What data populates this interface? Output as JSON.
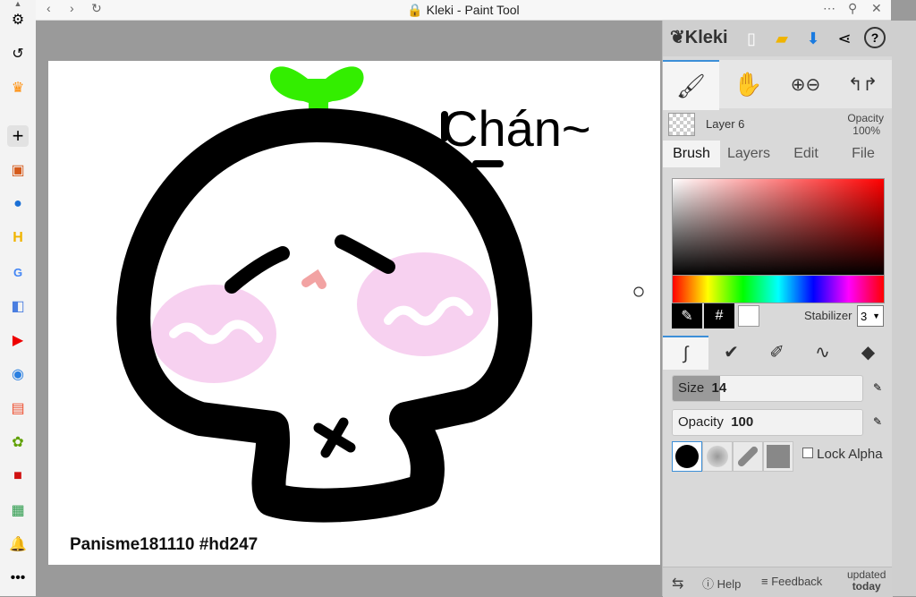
{
  "window": {
    "title": "Kleki - Paint Tool"
  },
  "app": {
    "logo": "Kleki",
    "layer": {
      "name": "Layer 6",
      "opacity_label": "Opacity",
      "opacity_value": "100%"
    },
    "tabs": [
      "Brush",
      "Layers",
      "Edit",
      "File"
    ],
    "color_picker": {
      "hash_symbol": "#",
      "stabilizer_label": "Stabilizer",
      "stabilizer_value": "3"
    },
    "size": {
      "label": "Size",
      "value": "14",
      "fraction": 0.25
    },
    "opacity": {
      "label": "Opacity",
      "value": "100",
      "fraction": 1.0
    },
    "lock_alpha_label": "Lock Alpha",
    "footer": {
      "help": "Help",
      "feedback": "Feedback",
      "updated": "updated",
      "updated_when": "today"
    }
  },
  "canvas": {
    "watermark": "Panisme181110 #hd247",
    "handwriting": "Chán~"
  },
  "colors": {
    "primary": "#000000",
    "secondary": "#ffffff",
    "accent": "#3c8fd8",
    "sprout": "#33ee00",
    "blush": "#f5c6ec"
  }
}
